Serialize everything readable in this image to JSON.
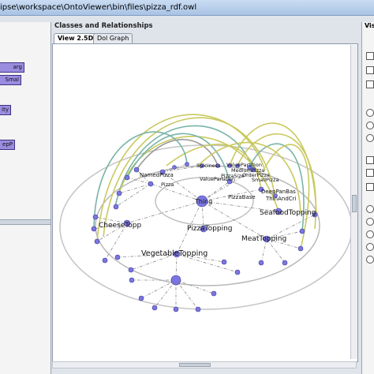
{
  "window": {
    "title": "ipse\\workspace\\OntoViewer\\bin\\files\\pizza_rdf.owl"
  },
  "left_panel": {
    "nodes": [
      "arg",
      "Smal",
      "ity",
      "epP"
    ]
  },
  "main": {
    "section_label": "Classes and Relationships",
    "tabs": [
      {
        "label": "View 2.5D",
        "active": true
      },
      {
        "label": "Dol Graph",
        "active": false
      }
    ]
  },
  "graph": {
    "labels": {
      "named_pizza": "NamedPizza",
      "spiciness": "Spiciness",
      "value_partition_top": "ValuePartition",
      "medium_pizza": "MediumPizza",
      "pizza_size": "PizzaSize",
      "pizza_dot": "Pizza",
      "order_pizza": "OrderPizza",
      "small_pizza": "SmallPizza",
      "value_partition_mid": "ValuePartition",
      "pizza_base": "PizzaBase",
      "deep_pan_base": "DeepPanBas",
      "thin_and_cri": "ThinAndCri",
      "thing": "Thing",
      "seafood_topping": "SeafoodTopping",
      "cheese_topp": "CheeseTopp",
      "pizza_topping": "PizzaTopping",
      "meat_topping": "MeatTopping",
      "vegetable_topping": "VegetableTopping"
    }
  },
  "right_panel": {
    "label": "Vis"
  },
  "colors": {
    "node": "#7b76df",
    "arc_green": "#c9c95f",
    "arc_teal": "#78b4a8",
    "edge": "#666666"
  }
}
